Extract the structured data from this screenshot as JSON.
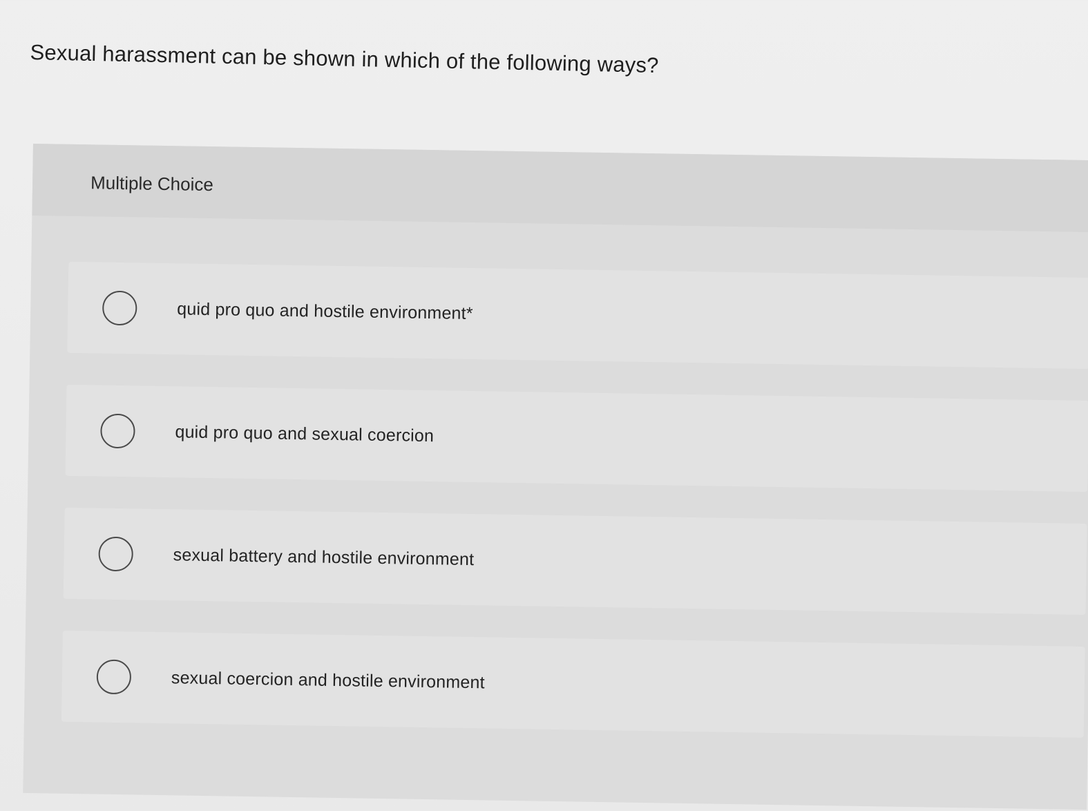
{
  "question": {
    "text": "Sexual harassment can be shown in which of the following ways?"
  },
  "panel": {
    "label": "Multiple Choice"
  },
  "options": [
    {
      "label": "quid pro quo and hostile environment*"
    },
    {
      "label": "quid pro quo and sexual coercion"
    },
    {
      "label": "sexual battery and hostile environment"
    },
    {
      "label": "sexual coercion and hostile environment"
    }
  ]
}
